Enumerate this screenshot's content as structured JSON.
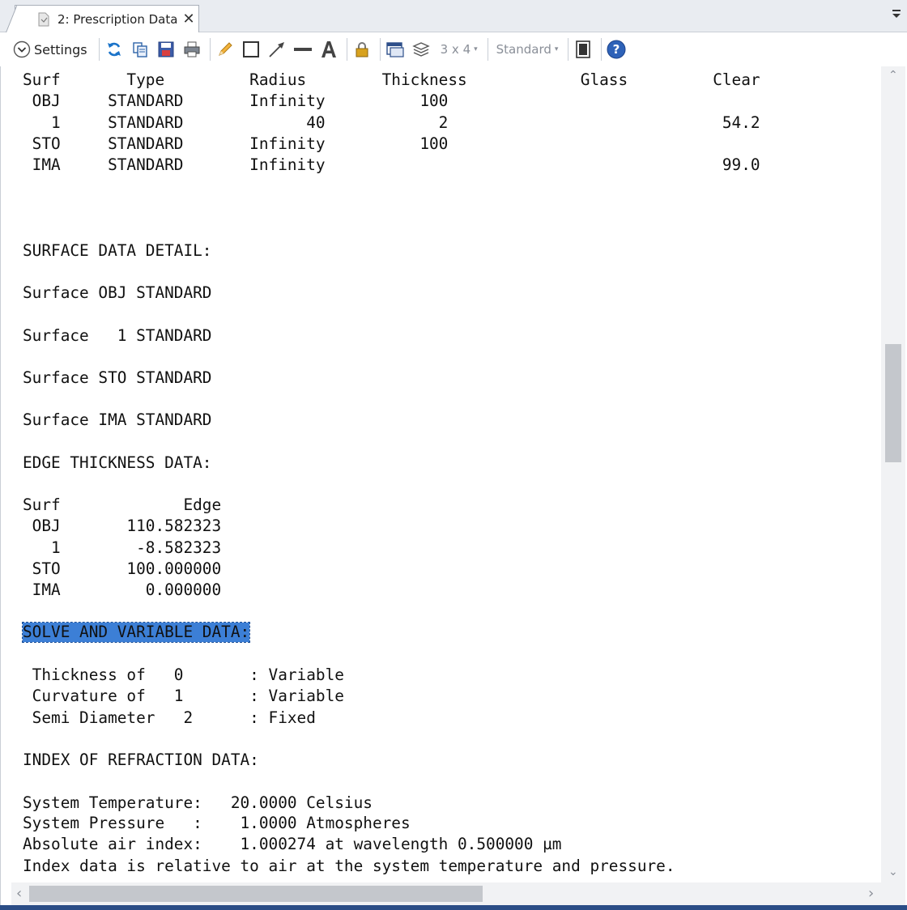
{
  "tab": {
    "title": "2: Prescription Data",
    "close": "✕"
  },
  "toolbar": {
    "settings_label": "Settings",
    "layout_value": "3 x 4",
    "style_value": "Standard",
    "caret": "▾",
    "icons": [
      "chevron-circle-down-icon",
      "refresh-icon",
      "copy-icon",
      "save-icon",
      "print-icon",
      "pencil-icon",
      "rectangle-icon",
      "arrow-icon",
      "line-icon",
      "text-icon",
      "lock-icon",
      "window-icon",
      "layers-icon",
      "fullscreen-icon",
      "help-icon"
    ]
  },
  "document": {
    "lines": [
      "Surf       Type         Radius        Thickness            Glass         Clear",
      " OBJ     STANDARD       Infinity          100",
      "   1     STANDARD             40            2                             54.2",
      " STO     STANDARD       Infinity          100",
      " IMA     STANDARD       Infinity                                          99.0",
      "",
      "",
      "",
      "SURFACE DATA DETAIL:",
      "",
      "Surface OBJ STANDARD",
      "",
      "Surface   1 STANDARD",
      "",
      "Surface STO STANDARD",
      "",
      "Surface IMA STANDARD",
      "",
      "EDGE THICKNESS DATA:",
      "",
      "Surf             Edge",
      " OBJ       110.582323",
      "   1        -8.582323",
      " STO       100.000000",
      " IMA         0.000000",
      "",
      "SOLVE AND VARIABLE DATA:",
      "",
      " Thickness of   0       : Variable",
      " Curvature of   1       : Variable",
      " Semi Diameter   2      : Fixed",
      "",
      "INDEX OF REFRACTION DATA:",
      "",
      "System Temperature:   20.0000 Celsius",
      "System Pressure   :    1.0000 Atmospheres",
      "Absolute air index:    1.000274 at wavelength 0.500000 µm",
      "Index data is relative to air at the system temperature and pressure."
    ]
  },
  "scroll": {
    "up": "⌃",
    "down": "⌄",
    "left": "‹",
    "right": "›"
  }
}
